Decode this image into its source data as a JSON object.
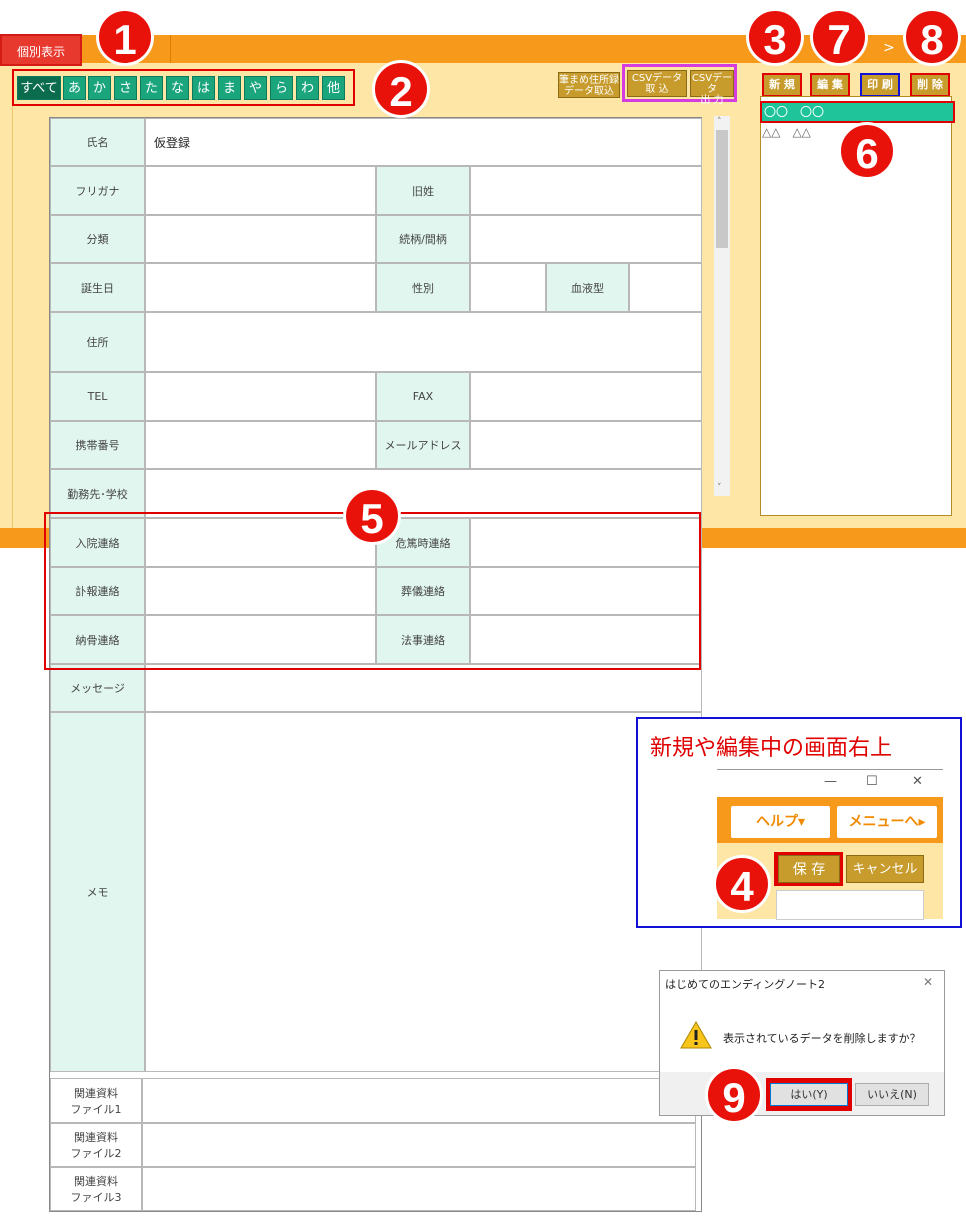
{
  "window": {
    "tab_label": "個別表示",
    "corner_icon": ">"
  },
  "kana_tabs": [
    "すべて",
    "あ",
    "か",
    "さ",
    "た",
    "な",
    "は",
    "ま",
    "や",
    "ら",
    "わ",
    "他"
  ],
  "toolbar": {
    "fude_import_l1": "筆まめ住所録",
    "fude_import_l2": "データ取込",
    "csv_import_l1": "CSVデータ",
    "csv_import_l2": "取 込",
    "csv_export_l1": "CSVデータ",
    "csv_export_l2": "出 力",
    "new_label": "新 規",
    "edit_label": "編 集",
    "print_label": "印 刷",
    "delete_label": "削 除"
  },
  "list": {
    "items": [
      "〇〇　〇〇",
      "△△　△△"
    ]
  },
  "form": {
    "name_label": "氏名",
    "name_value": "仮登録",
    "furigana_label": "フリガナ",
    "maiden_label": "旧姓",
    "category_label": "分類",
    "relation_label": "続柄/間柄",
    "birthday_label": "誕生日",
    "gender_label": "性別",
    "blood_label": "血液型",
    "address_label": "住所",
    "tel_label": "TEL",
    "fax_label": "FAX",
    "mobile_label": "携帯番号",
    "mail_label": "メールアドレス",
    "work_label": "勤務先･学校",
    "hospital_label": "入院連絡",
    "critical_label": "危篤時連絡",
    "death_label": "訃報連絡",
    "funeral_label": "葬儀連絡",
    "burial_label": "納骨連絡",
    "memorial_label": "法事連絡",
    "message_label": "メッセージ",
    "memo_label": "メモ",
    "file1_l1": "関連資料",
    "file1_l2": "ファイル1",
    "file2_l1": "関連資料",
    "file2_l2": "ファイル2",
    "file3_l1": "関連資料",
    "file3_l2": "ファイル3"
  },
  "callouts": [
    "1",
    "2",
    "3",
    "4",
    "5",
    "6",
    "7",
    "8",
    "9"
  ],
  "inset": {
    "title": "新規や編集中の画面右上",
    "min_icon": "—",
    "max_icon": "☐",
    "close_icon": "✕",
    "help_label": "ヘルプ▾",
    "menu_label": "メニューへ▸",
    "save_label": "保 存",
    "cancel_label": "キャンセル"
  },
  "dialog": {
    "title": "はじめてのエンディングノート2",
    "close_icon": "✕",
    "message": "表示されているデータを削除しますか？",
    "yes_label": "はい(Y)",
    "no_label": "いいえ(N)"
  },
  "colors": {
    "orange": "#f79a1b",
    "cream": "#fde6a6",
    "green": "#1aa57d",
    "gold": "#c79b2c",
    "red": "#e8120b"
  }
}
